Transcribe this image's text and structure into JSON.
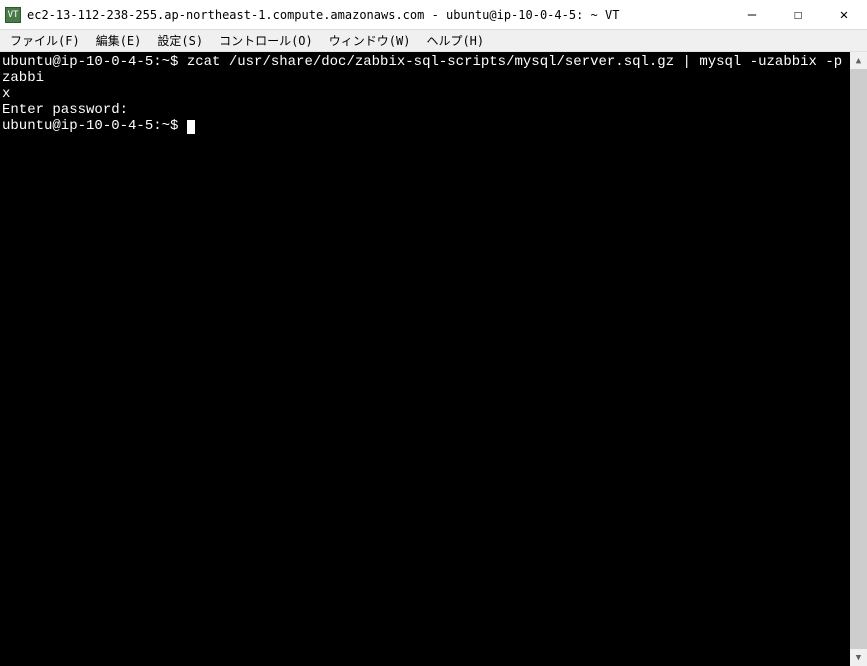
{
  "window": {
    "title": "ec2-13-112-238-255.ap-northeast-1.compute.amazonaws.com - ubuntu@ip-10-0-4-5: ~ VT",
    "icon_text": "VT"
  },
  "controls": {
    "minimize": "—",
    "maximize": "☐",
    "close": "✕"
  },
  "menu": {
    "file": "ファイル(F)",
    "edit": "編集(E)",
    "settings": "設定(S)",
    "control": "コントロール(O)",
    "window": "ウィンドウ(W)",
    "help": "ヘルプ(H)"
  },
  "terminal": {
    "line1": "ubuntu@ip-10-0-4-5:~$ zcat /usr/share/doc/zabbix-sql-scripts/mysql/server.sql.gz | mysql -uzabbix -p zabbi",
    "line2": "x",
    "line3": "Enter password:",
    "line4": "ubuntu@ip-10-0-4-5:~$ "
  },
  "scrollbar": {
    "up_arrow": "▲",
    "down_arrow": "▼"
  }
}
